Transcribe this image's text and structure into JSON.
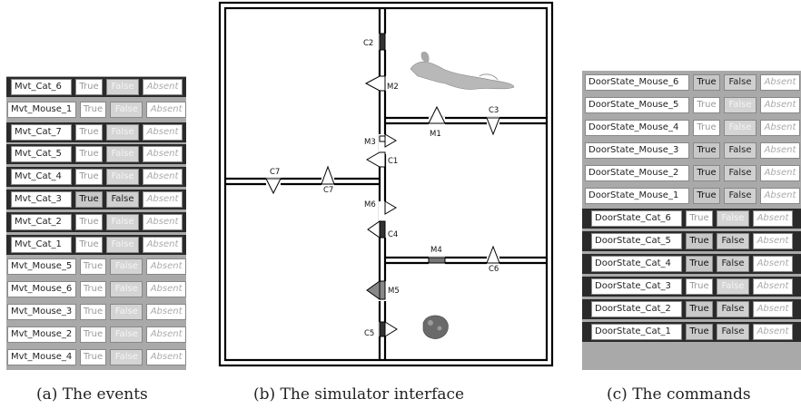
{
  "events": {
    "caption": "(a) The events",
    "rows": [
      {
        "name": "Mvt_Cat_6",
        "state": "false",
        "true_label": "True",
        "false_label": "False",
        "absent_label": "Absent"
      },
      {
        "name": "Mvt_Mouse_1",
        "state": "false",
        "true_label": "True",
        "false_label": "False",
        "absent_label": "Absent"
      },
      {
        "name": "Mvt_Cat_7",
        "state": "false",
        "true_label": "True",
        "false_label": "False",
        "absent_label": "Absent"
      },
      {
        "name": "Mvt_Cat_5",
        "state": "false",
        "true_label": "True",
        "false_label": "False",
        "absent_label": "Absent"
      },
      {
        "name": "Mvt_Cat_4",
        "state": "false",
        "true_label": "True",
        "false_label": "False",
        "absent_label": "Absent"
      },
      {
        "name": "Mvt_Cat_3",
        "state": "true",
        "true_label": "True",
        "false_label": "False",
        "absent_label": "Absent"
      },
      {
        "name": "Mvt_Cat_2",
        "state": "false",
        "true_label": "True",
        "false_label": "False",
        "absent_label": "Absent"
      },
      {
        "name": "Mvt_Cat_1",
        "state": "false",
        "true_label": "True",
        "false_label": "False",
        "absent_label": "Absent"
      },
      {
        "name": "Mvt_Mouse_5",
        "state": "false",
        "true_label": "True",
        "false_label": "False",
        "absent_label": "Absent"
      },
      {
        "name": "Mvt_Mouse_6",
        "state": "false",
        "true_label": "True",
        "false_label": "False",
        "absent_label": "Absent"
      },
      {
        "name": "Mvt_Mouse_3",
        "state": "false",
        "true_label": "True",
        "false_label": "False",
        "absent_label": "Absent"
      },
      {
        "name": "Mvt_Mouse_2",
        "state": "false",
        "true_label": "True",
        "false_label": "False",
        "absent_label": "Absent"
      },
      {
        "name": "Mvt_Mouse_4",
        "state": "false",
        "true_label": "True",
        "false_label": "False",
        "absent_label": "Absent"
      }
    ]
  },
  "simulator": {
    "caption": "(b) The simulator interface",
    "doors": {
      "C1": "C1",
      "C2": "C2",
      "C3": "C3",
      "C4": "C4",
      "C5": "C5",
      "C6": "C6",
      "C7a": "C7",
      "C7b": "C7",
      "M1": "M1",
      "M2": "M2",
      "M3": "M3",
      "M4": "M4",
      "M5": "M5",
      "M6": "M6"
    },
    "colors": {
      "wall": "#000000",
      "door_closed": "#333333",
      "door_marked": "#777777",
      "cat": "#b8b8b8",
      "mouse": "#6a6a6a"
    }
  },
  "commands": {
    "caption": "(c) The commands",
    "rows": [
      {
        "name": "DoorState_Mouse_6",
        "state": "true",
        "true_label": "True",
        "false_label": "False",
        "absent_label": "Absent"
      },
      {
        "name": "DoorState_Mouse_5",
        "state": "false",
        "true_label": "True",
        "false_label": "False",
        "absent_label": "Absent"
      },
      {
        "name": "DoorState_Mouse_4",
        "state": "false",
        "true_label": "True",
        "false_label": "False",
        "absent_label": "Absent"
      },
      {
        "name": "DoorState_Mouse_3",
        "state": "true",
        "true_label": "True",
        "false_label": "False",
        "absent_label": "Absent"
      },
      {
        "name": "DoorState_Mouse_2",
        "state": "true",
        "true_label": "True",
        "false_label": "False",
        "absent_label": "Absent"
      },
      {
        "name": "DoorState_Mouse_1",
        "state": "true",
        "true_label": "True",
        "false_label": "False",
        "absent_label": "Absent"
      },
      {
        "name": "DoorState_Cat_6",
        "state": "false",
        "true_label": "True",
        "false_label": "False",
        "absent_label": "Absent"
      },
      {
        "name": "DoorState_Cat_5",
        "state": "true",
        "true_label": "True",
        "false_label": "False",
        "absent_label": "Absent"
      },
      {
        "name": "DoorState_Cat_4",
        "state": "true",
        "true_label": "True",
        "false_label": "False",
        "absent_label": "Absent"
      },
      {
        "name": "DoorState_Cat_3",
        "state": "false",
        "true_label": "True",
        "false_label": "False",
        "absent_label": "Absent"
      },
      {
        "name": "DoorState_Cat_2",
        "state": "true",
        "true_label": "True",
        "false_label": "False",
        "absent_label": "Absent"
      },
      {
        "name": "DoorState_Cat_1",
        "state": "true",
        "true_label": "True",
        "false_label": "False",
        "absent_label": "Absent"
      }
    ]
  }
}
